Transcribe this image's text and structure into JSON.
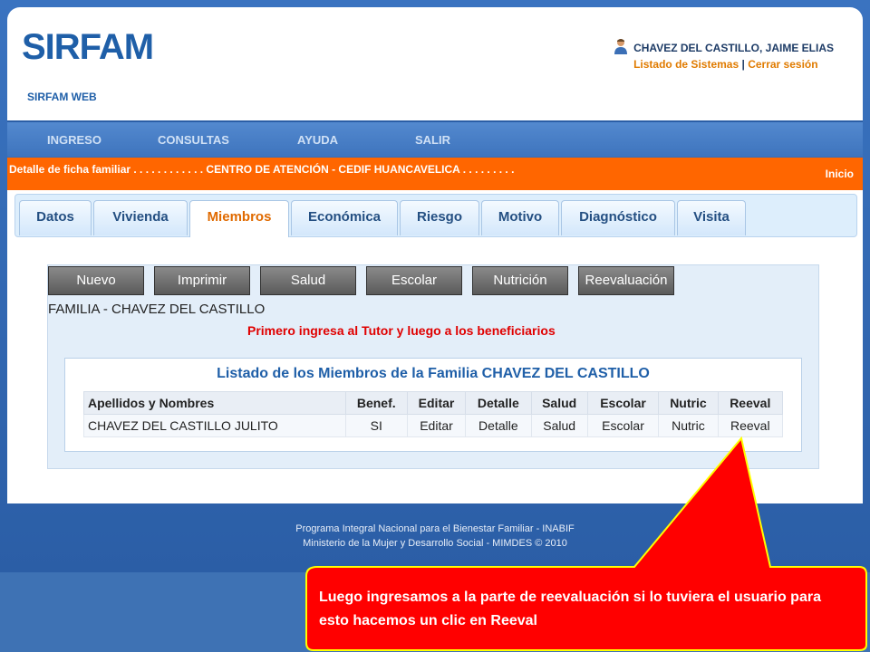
{
  "header": {
    "logo": "SIRFAM",
    "subtitle": "SIRFAM WEB",
    "user_name": "CHAVEZ DEL CASTILLO, JAIME ELIAS",
    "link_systems": "Listado de Sistemas",
    "separator": "|",
    "link_logout": "Cerrar sesión"
  },
  "nav": {
    "items": [
      "INGRESO",
      "CONSULTAS",
      "AYUDA",
      "SALIR"
    ]
  },
  "breadcrumb": {
    "text": "Detalle de ficha familiar . . . . . . . . . . . . CENTRO DE ATENCIÓN - CEDIF HUANCAVELICA . . . . . . . . .",
    "home": "Inicio"
  },
  "tabs": {
    "items": [
      "Datos",
      "Vivienda",
      "Miembros",
      "Económica",
      "Riesgo",
      "Motivo",
      "Diagnóstico",
      "Visita"
    ],
    "active": "Miembros"
  },
  "actions": {
    "buttons": [
      "Nuevo",
      "Imprimir",
      "Salud",
      "Escolar",
      "Nutrición",
      "Reevaluación"
    ]
  },
  "family_label": "FAMILIA - CHAVEZ DEL CASTILLO",
  "warning": "Primero ingresa al Tutor y luego a los beneficiarios",
  "members": {
    "title": "Listado de los Miembros de la Familia CHAVEZ DEL CASTILLO",
    "columns": [
      "Apellidos y Nombres",
      "Benef.",
      "Editar",
      "Detalle",
      "Salud",
      "Escolar",
      "Nutric",
      "Reeval"
    ],
    "rows": [
      [
        "CHAVEZ DEL CASTILLO JULITO",
        "SI",
        "Editar",
        "Detalle",
        "Salud",
        "Escolar",
        "Nutric",
        "Reeval"
      ]
    ]
  },
  "footer": {
    "line1": "Programa Integral Nacional para el Bienestar Familiar - INABIF",
    "line2": "Ministerio de la Mujer y Desarrollo Social - MIMDES © 2010"
  },
  "callout": {
    "text": "Luego ingresamos a la parte de reevaluación si lo tuviera el usuario  para esto  hacemos un clic en Reeval",
    "fill_color": "#ff0000",
    "border_color": "#ffff00"
  },
  "colors": {
    "brand_blue": "#1f5fa8",
    "accent_orange": "#ff6600",
    "active_tab": "#e06a00"
  }
}
